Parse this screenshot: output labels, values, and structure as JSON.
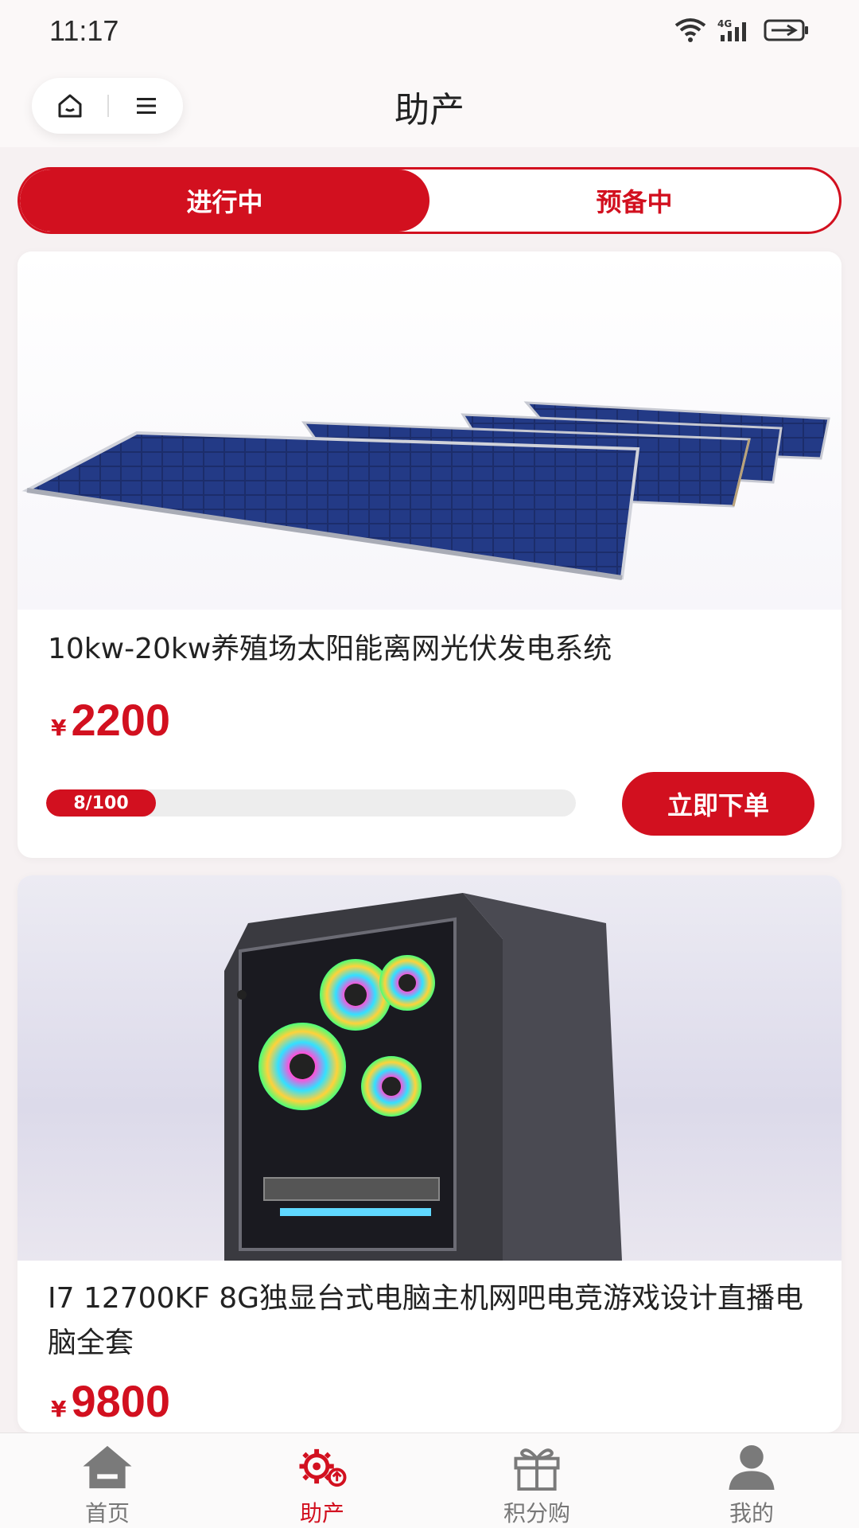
{
  "status_bar": {
    "time": "11:17",
    "icons": [
      "wifi-icon",
      "signal-4g-icon",
      "battery-charging-icon"
    ]
  },
  "header": {
    "title": "助产",
    "capsule_icons": [
      "home-icon",
      "menu-icon"
    ]
  },
  "tabs": [
    {
      "label": "进行中",
      "active": true
    },
    {
      "label": "预备中",
      "active": false
    }
  ],
  "products": [
    {
      "title": "10kw-20kw养殖场太阳能离网光伏发电系统",
      "currency": "¥",
      "price": "2200",
      "progress_label": "8/100",
      "progress_fraction": 0.08,
      "button_label": "立即下单",
      "image": "solar-panels-image"
    },
    {
      "title": "I7 12700KF 8G独显台式电脑主机网吧电竞游戏设计直播电脑全套",
      "currency": "¥",
      "price": "9800",
      "image": "desktop-pc-case-image"
    }
  ],
  "bottom_nav": [
    {
      "label": "首页",
      "icon": "home-icon",
      "active": false
    },
    {
      "label": "助产",
      "icon": "gears-up-icon",
      "active": true
    },
    {
      "label": "积分购",
      "icon": "gift-icon",
      "active": false
    },
    {
      "label": "我的",
      "icon": "user-icon",
      "active": false
    }
  ],
  "colors": {
    "accent": "#d2101f",
    "nav_inactive": "#777777"
  }
}
